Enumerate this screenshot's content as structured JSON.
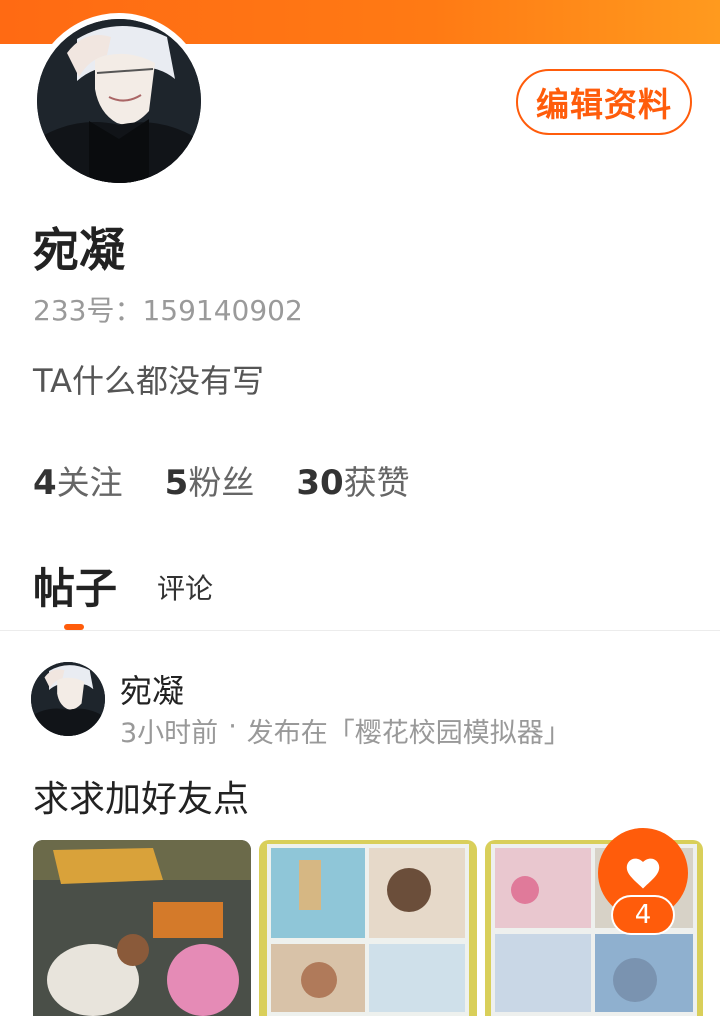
{
  "profile": {
    "edit_label": "编辑资料",
    "name": "宛凝",
    "uid": "233号：159140902",
    "bio": "TA什么都没有写",
    "stats": [
      {
        "num": "4",
        "label": "关注"
      },
      {
        "num": "5",
        "label": "粉丝"
      },
      {
        "num": "30",
        "label": "获赞"
      }
    ]
  },
  "tabs": {
    "posts": "帖子",
    "comments": "评论",
    "active": "帖子"
  },
  "post": {
    "author": "宛凝",
    "time": "3小时前",
    "separator": "·",
    "published_in": "发布在「樱花校园模拟器」",
    "title": "求求加好友点",
    "like_count": "4"
  },
  "icons": {
    "like": "heart-icon",
    "avatar": "avatar-image"
  },
  "colors": {
    "accent": "#ff5c0b",
    "header_gradient_start": "#ff6a13",
    "header_gradient_end": "#ff9a1e"
  }
}
